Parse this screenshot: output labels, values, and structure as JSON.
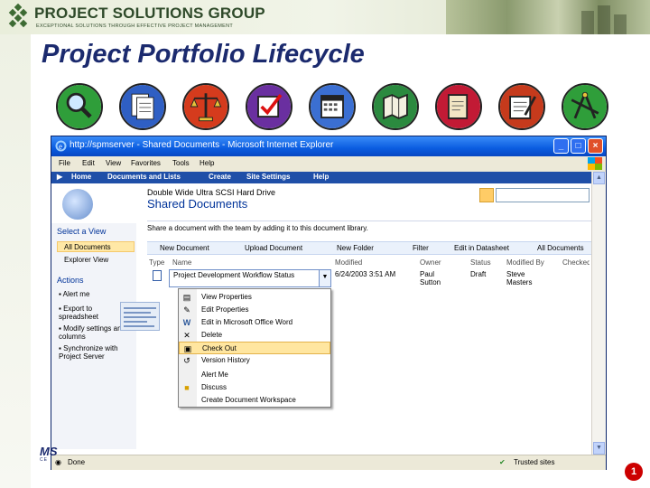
{
  "header": {
    "company": "PROJECT SOLUTIONS GROUP",
    "tagline": "EXCEPTIONAL SOLUTIONS THROUGH EFFECTIVE PROJECT MANAGEMENT"
  },
  "slide": {
    "title": "Project Portfolio Lifecycle",
    "page_number": "1"
  },
  "lifecycle_icons": [
    {
      "name": "magnifier-icon",
      "bg": "#2f9e3a"
    },
    {
      "name": "documents-icon",
      "bg": "#2f5fc4"
    },
    {
      "name": "scales-icon",
      "bg": "#d53b1d"
    },
    {
      "name": "checkbox-icon",
      "bg": "#6a2fa0"
    },
    {
      "name": "calendar-icon",
      "bg": "#3b6fd2"
    },
    {
      "name": "map-icon",
      "bg": "#2b8a3f"
    },
    {
      "name": "notes-icon",
      "bg": "#c21a35"
    },
    {
      "name": "report-icon",
      "bg": "#c63a1c"
    },
    {
      "name": "compass-icon",
      "bg": "#2f9e3a"
    }
  ],
  "browser": {
    "title": "http://spmserver - Shared Documents - Microsoft Internet Explorer",
    "menu": [
      "File",
      "Edit",
      "View",
      "Favorites",
      "Tools",
      "Help"
    ],
    "sp_nav": [
      "Home",
      "Documents and Lists",
      "Create",
      "Site Settings",
      "Help"
    ],
    "status_left": "Done",
    "status_right": "Trusted sites"
  },
  "sharepoint": {
    "site_title": "Double Wide Ultra SCSI Hard Drive",
    "library_title": "Shared Documents",
    "description": "Share a document with the team by adding it to this document library.",
    "search_placeholder": "",
    "quicklaunch": {
      "select_view_heading": "Select a View",
      "views": [
        "All Documents",
        "Explorer View"
      ],
      "actions_heading": "Actions",
      "actions": [
        "Alert me",
        "Export to spreadsheet",
        "Modify settings and columns",
        "Synchronize with Project Server"
      ]
    },
    "toolbar": [
      "New Document",
      "Upload Document",
      "New Folder",
      "Filter",
      "Edit in Datasheet",
      "All Documents"
    ],
    "columns": [
      "Type",
      "Name",
      "Modified",
      "Owner",
      "Status",
      "Modified By",
      "Checked"
    ],
    "row": {
      "name": "Project Development Workflow Status",
      "modified": "6/24/2003 3:51 AM",
      "owner": "Paul Sutton",
      "status": "Draft",
      "modified_by": "Steve Masters"
    },
    "context_menu": [
      {
        "label": "View Properties",
        "icon": "properties-icon",
        "highlight": false
      },
      {
        "label": "Edit Properties",
        "icon": "edit-properties-icon",
        "highlight": false
      },
      {
        "label": "Edit in Microsoft Office Word",
        "icon": "word-icon",
        "highlight": false
      },
      {
        "label": "Delete",
        "icon": "delete-icon",
        "highlight": false
      },
      {
        "label": "Check Out",
        "icon": "check-out-icon",
        "highlight": true
      },
      {
        "label": "Version History",
        "icon": "history-icon",
        "highlight": false
      },
      {
        "label": "Alert Me",
        "icon": "alert-icon",
        "highlight": false
      },
      {
        "label": "Discuss",
        "icon": "discuss-icon",
        "highlight": false
      },
      {
        "label": "Create Document Workspace",
        "icon": "workspace-icon",
        "highlight": false
      }
    ]
  },
  "footer": {
    "badge": "MS",
    "badge_sub": "CE"
  }
}
